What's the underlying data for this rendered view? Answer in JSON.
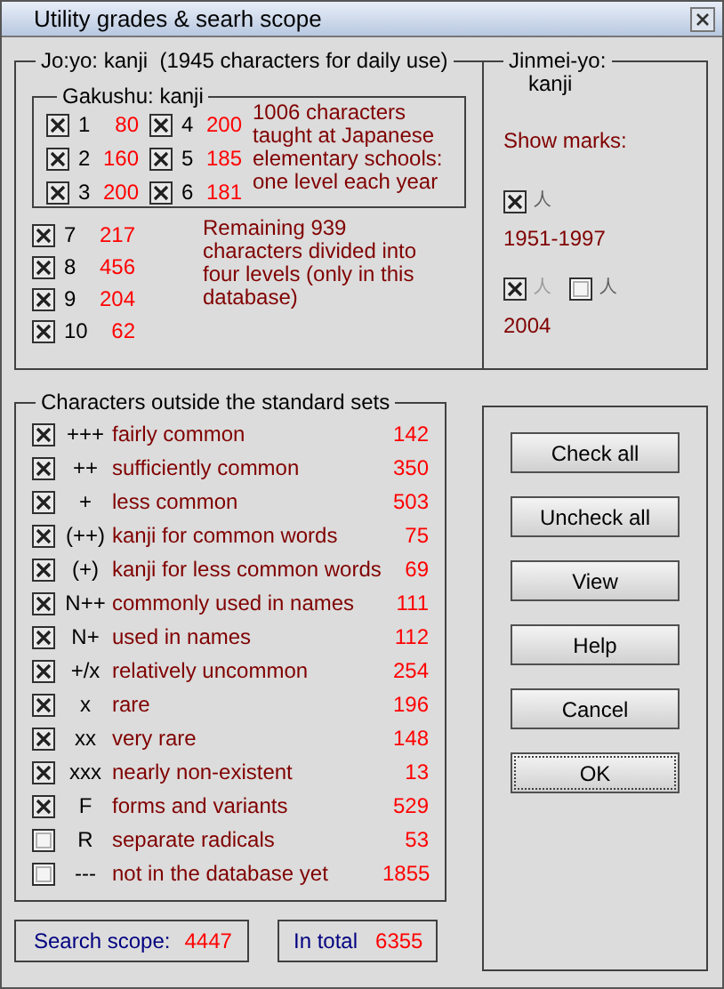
{
  "window": {
    "title": "Utility grades & searh scope"
  },
  "joyo": {
    "title": "Jo:yo: kanji  (1945 characters for daily use)",
    "gakushu": {
      "title": "Gakushu: kanji",
      "note": "1006 characters taught at Japanese elementary schools: one level each year",
      "levels": [
        {
          "label": "1",
          "count": "80",
          "checked": true
        },
        {
          "label": "2",
          "count": "160",
          "checked": true
        },
        {
          "label": "3",
          "count": "200",
          "checked": true
        },
        {
          "label": "4",
          "count": "200",
          "checked": true
        },
        {
          "label": "5",
          "count": "185",
          "checked": true
        },
        {
          "label": "6",
          "count": "181",
          "checked": true
        }
      ]
    },
    "levels": [
      {
        "label": "7",
        "count": "217",
        "checked": true
      },
      {
        "label": "8",
        "count": "456",
        "checked": true
      },
      {
        "label": "9",
        "count": "204",
        "checked": true
      },
      {
        "label": "10",
        "count": "62",
        "checked": true
      }
    ],
    "note": "Remaining 939 characters divided into four levels (only in this database)"
  },
  "jinmei": {
    "title": "Jinmei-yo:",
    "subtitle": "kanji",
    "show_marks_label": "Show marks:",
    "groups": [
      {
        "label": "1951-1997",
        "marks": [
          {
            "checked": true,
            "glyph": "人",
            "faded": false
          }
        ]
      },
      {
        "label": "2004",
        "marks": [
          {
            "checked": true,
            "glyph": "人",
            "faded": true
          },
          {
            "checked": false,
            "glyph": "人",
            "faded": false
          }
        ]
      }
    ]
  },
  "outside": {
    "title": "Characters outside the standard sets",
    "rows": [
      {
        "checked": true,
        "code": "+++",
        "description": "fairly common",
        "count": "142"
      },
      {
        "checked": true,
        "code": "++",
        "description": "sufficiently common",
        "count": "350"
      },
      {
        "checked": true,
        "code": "+",
        "description": "less common",
        "count": "503"
      },
      {
        "checked": true,
        "code": "(++)",
        "description": "kanji for common words",
        "count": "75"
      },
      {
        "checked": true,
        "code": "(+)",
        "description": "kanji for less common words",
        "count": "69"
      },
      {
        "checked": true,
        "code": "N++",
        "description": "commonly used in names",
        "count": "111"
      },
      {
        "checked": true,
        "code": "N+",
        "description": "used in names",
        "count": "112"
      },
      {
        "checked": true,
        "code": "+/x",
        "description": "relatively uncommon",
        "count": "254"
      },
      {
        "checked": true,
        "code": "x",
        "description": "rare",
        "count": "196"
      },
      {
        "checked": true,
        "code": "xx",
        "description": "very rare",
        "count": "148"
      },
      {
        "checked": true,
        "code": "xxx",
        "description": "nearly non-existent",
        "count": "13"
      },
      {
        "checked": true,
        "code": "F",
        "description": "forms and variants",
        "count": "529"
      },
      {
        "checked": false,
        "code": "R",
        "description": "separate radicals",
        "count": "53"
      },
      {
        "checked": false,
        "code": "---",
        "description": "not in the database yet",
        "count": "1855"
      }
    ]
  },
  "buttons": [
    {
      "label": "Check all",
      "focused": false
    },
    {
      "label": "Uncheck all",
      "focused": false
    },
    {
      "label": "View",
      "focused": false
    },
    {
      "label": "Help",
      "focused": false
    },
    {
      "label": "Cancel",
      "focused": false
    },
    {
      "label": "OK",
      "focused": true
    }
  ],
  "search_scope": {
    "label": "Search scope:",
    "value": "4447"
  },
  "total": {
    "label": "In total",
    "value": "6355"
  }
}
